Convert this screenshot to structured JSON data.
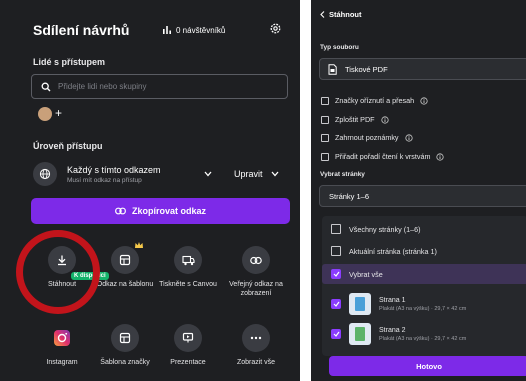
{
  "share": {
    "title": "Sdílení návrhů",
    "visitors": "0 návštěvníků",
    "people_label": "Lidé s přístupem",
    "search_placeholder": "Přidejte lidi nebo skupiny",
    "access_label": "Úroveň přístupu",
    "access_main": "Každý s tímto odkazem",
    "access_sub": "Musí mít odkaz na přístup",
    "permission": "Upravit",
    "copy_button": "Zkopírovat odkaz",
    "badge": "K dispozici",
    "actions": [
      {
        "label": "Stáhnout",
        "icon": "download-icon"
      },
      {
        "label": "Odkaz na šablonu",
        "icon": "template-link-icon"
      },
      {
        "label": "Tiskněte s Canvou",
        "icon": "print-truck-icon"
      },
      {
        "label": "Veřejný odkaz na zobrazení",
        "icon": "public-link-icon"
      },
      {
        "label": "Instagram",
        "icon": "instagram-icon"
      },
      {
        "label": "Šablona značky",
        "icon": "brand-template-icon"
      },
      {
        "label": "Prezentace",
        "icon": "presentation-icon"
      },
      {
        "label": "Zobrazit vše",
        "icon": "more-icon"
      }
    ]
  },
  "download": {
    "back": "Stáhnout",
    "filetype_label": "Typ souboru",
    "filetype": "Tiskové PDF",
    "options": [
      "Značky oříznutí a přesah",
      "Zploštit PDF",
      "Zahrnout poznámky",
      "Přiřadit pořadí čtení k vrstvám"
    ],
    "pages_label": "Vybrat stránky",
    "pages_value": "Stránky 1–6",
    "dropdown": {
      "all_pages": "Všechny stránky (1–6)",
      "current_page": "Aktuální stránka (stránka 1)",
      "select_all": "Vybrat vše",
      "pages": [
        {
          "title": "Strana 1",
          "sub": "Plakát (A3 na výšku) · 29,7 × 42 cm"
        },
        {
          "title": "Strana 2",
          "sub": "Plakát (A3 na výšku) · 29,7 × 42 cm"
        }
      ]
    },
    "done_button": "Hotovo"
  },
  "colors": {
    "accent": "#7d2ae8",
    "panel": "#1e1f22",
    "highlight": "#c2141b",
    "badge": "#14b36b"
  }
}
